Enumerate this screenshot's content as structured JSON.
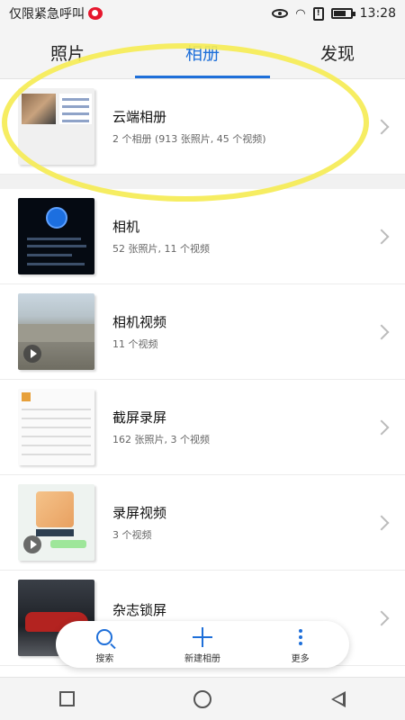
{
  "status_bar": {
    "carrier_text": "仅限紧急呼叫",
    "time": "13:28",
    "sim_label": "!"
  },
  "tabs": [
    {
      "label": "照片",
      "active": false
    },
    {
      "label": "相册",
      "active": true
    },
    {
      "label": "发现",
      "active": false
    }
  ],
  "albums": [
    {
      "name": "云端相册",
      "count": "2 个相册 (913 张照片, 45 个视频)"
    },
    {
      "name": "相机",
      "count": "52 张照片, 11 个视频"
    },
    {
      "name": "相机视频",
      "count": "11 个视频"
    },
    {
      "name": "截屏录屏",
      "count": "162 张照片, 3 个视频"
    },
    {
      "name": "录屏视频",
      "count": "3 个视频"
    },
    {
      "name": "杂志锁屏",
      "count": "???"
    }
  ],
  "toolbar": {
    "search_label": "搜索",
    "new_album_label": "新建相册",
    "more_label": "更多"
  },
  "colors": {
    "accent": "#1e6fd9",
    "highlight": "#f5ec55"
  },
  "icons": [
    "weibo-icon",
    "eye-icon",
    "wifi-icon",
    "sim-alert-icon",
    "battery-icon",
    "chevron-right-icon",
    "search-icon",
    "plus-icon",
    "more-dots-icon",
    "recents-icon",
    "home-icon",
    "back-icon"
  ]
}
